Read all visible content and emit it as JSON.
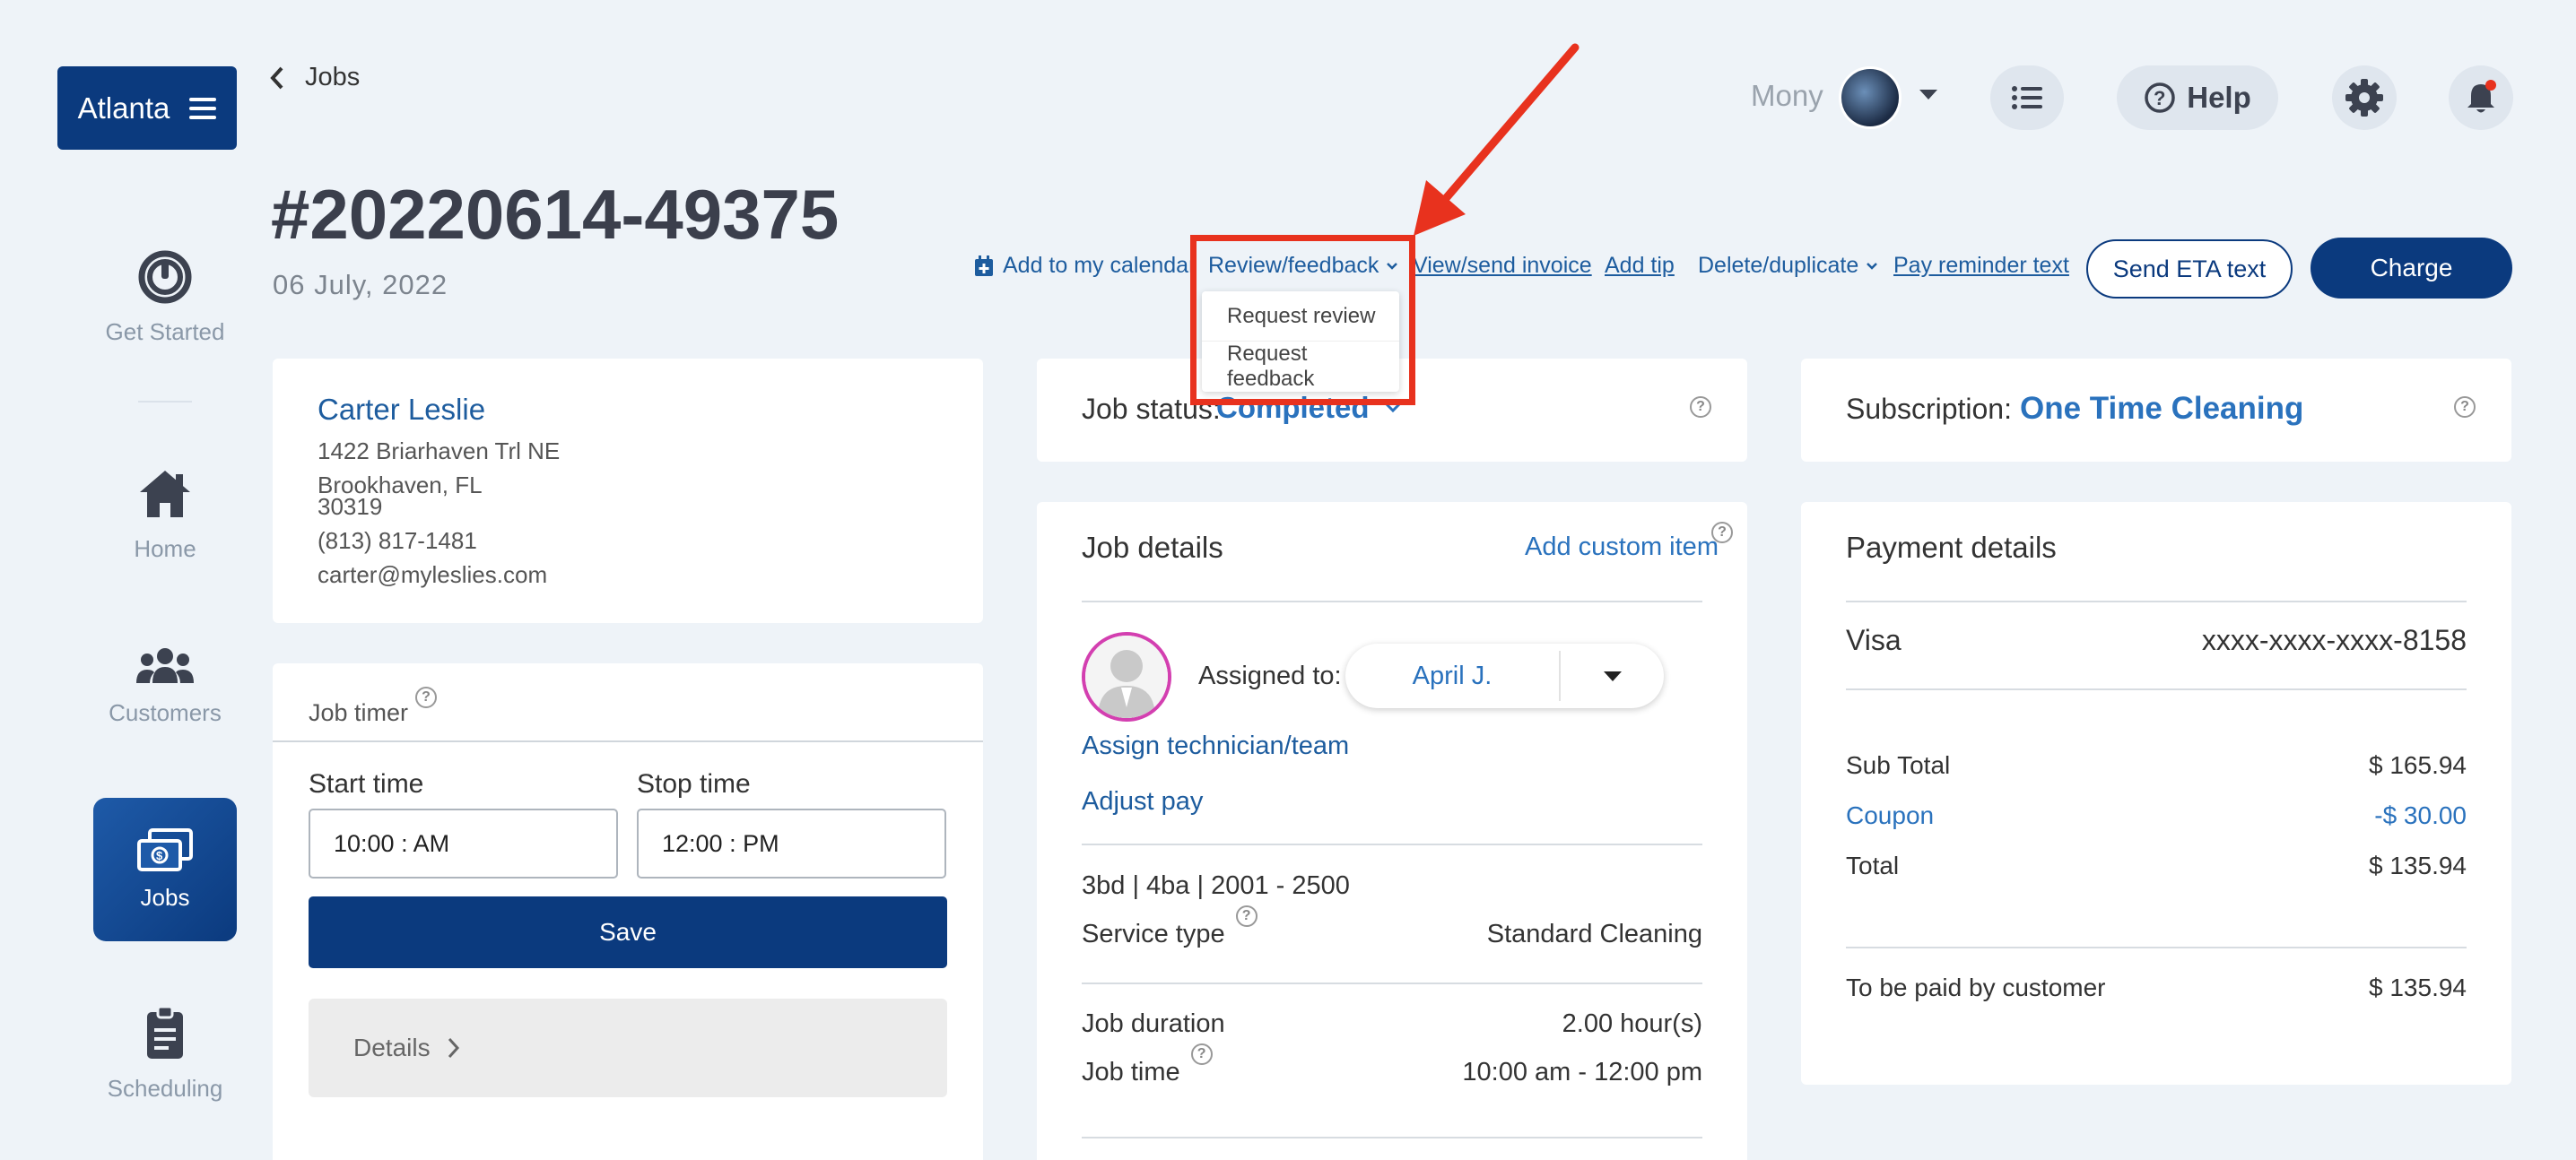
{
  "sidebar": {
    "location_button": "Atlanta",
    "items": [
      {
        "label": "Get Started",
        "icon": "power-icon"
      },
      {
        "label": "Home",
        "icon": "home-icon"
      },
      {
        "label": "Customers",
        "icon": "customers-icon"
      },
      {
        "label": "Jobs",
        "icon": "jobs-icon"
      },
      {
        "label": "Scheduling",
        "icon": "clipboard-icon"
      }
    ]
  },
  "header": {
    "back_label": "Jobs",
    "job_number": "#20220614-49375",
    "job_date": "06 July, 2022",
    "user_name": "Mony",
    "help_label": "Help"
  },
  "actions": {
    "add_calendar": "Add to my calendar",
    "review_feedback": "Review/feedback",
    "view_send_invoice": "View/send invoice",
    "add_tip": "Add tip",
    "delete_duplicate": "Delete/duplicate",
    "pay_reminder": "Pay reminder text",
    "send_eta": "Send ETA text",
    "charge": "Charge"
  },
  "review_menu": {
    "items": [
      "Request review",
      "Request feedback"
    ]
  },
  "customer": {
    "name": "Carter Leslie",
    "address_line1": "1422 Briarhaven Trl NE",
    "address_line2": "Brookhaven, FL",
    "zip": "30319",
    "phone": "(813) 817-1481",
    "email": "carter@myleslies.com"
  },
  "job_timer": {
    "title": "Job timer",
    "start_label": "Start time",
    "stop_label": "Stop time",
    "start_value": "10:00 : AM",
    "stop_value": "12:00 : PM",
    "save_label": "Save",
    "details_label": "Details"
  },
  "job_status": {
    "label": "Job status:",
    "value": "Completed"
  },
  "job_details": {
    "title": "Job details",
    "add_custom_item": "Add custom item",
    "assigned_label": "Assigned to:",
    "assigned_value": "April J.",
    "assign_link": "Assign technician/team",
    "adjust_pay": "Adjust pay",
    "property": "3bd | 4ba | 2001 - 2500",
    "service_type_label": "Service type",
    "service_type_value": "Standard Cleaning",
    "duration_label": "Job duration",
    "duration_value": "2.00 hour(s)",
    "job_time_label": "Job time",
    "job_time_value": "10:00 am - 12:00 pm"
  },
  "subscription": {
    "label": "Subscription:",
    "value": "One Time Cleaning"
  },
  "payment": {
    "title": "Payment details",
    "card_type": "Visa",
    "card_number": "xxxx-xxxx-xxxx-8158",
    "subtotal_label": "Sub Total",
    "subtotal_value": "$ 165.94",
    "coupon_label": "Coupon",
    "coupon_value": "-$ 30.00",
    "total_label": "Total",
    "total_value": "$ 135.94",
    "to_pay_label": "To be paid by customer",
    "to_pay_value": "$ 135.94"
  },
  "colors": {
    "primary": "#0b3a7e",
    "link": "#1d5c9e",
    "highlight": "#e8321e",
    "background": "#eef3f8"
  }
}
